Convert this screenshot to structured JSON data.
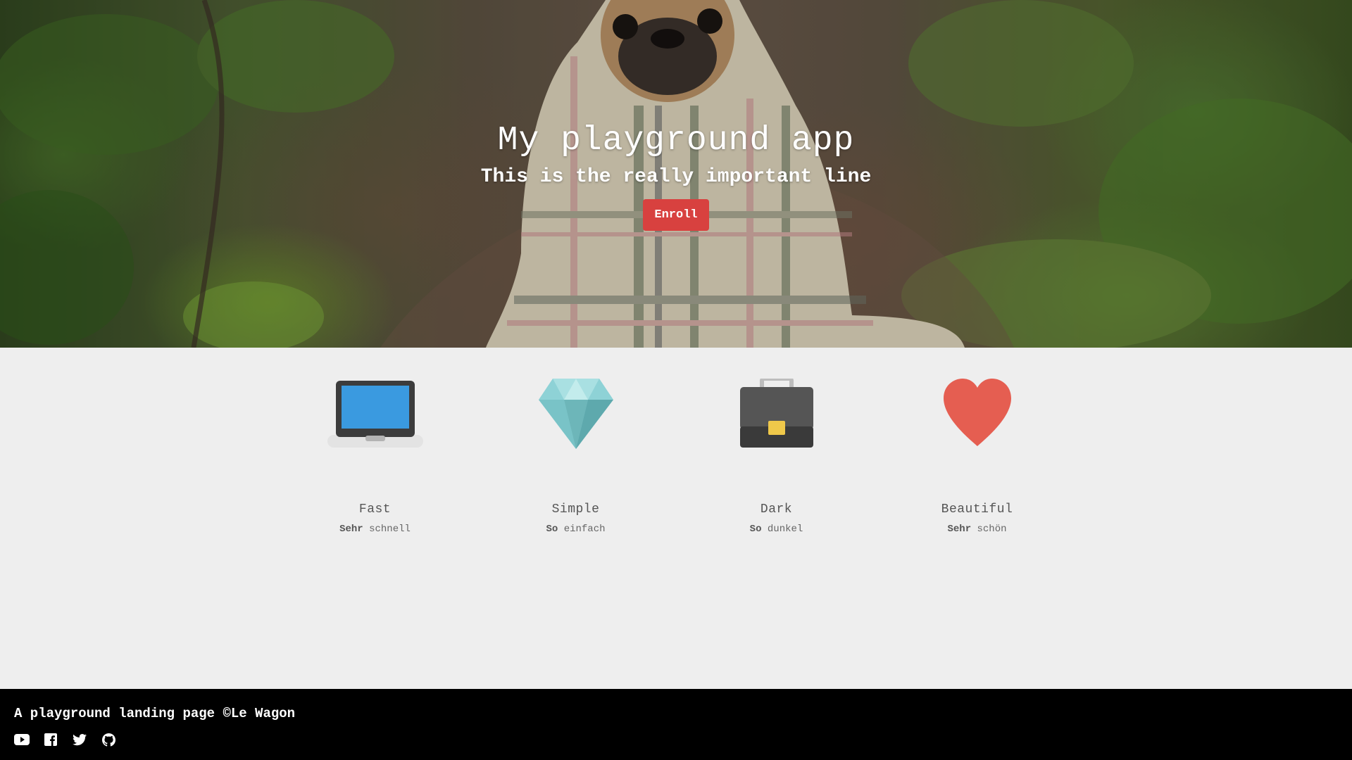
{
  "hero": {
    "title": "My playground app",
    "subtitle": "This is the really important line",
    "cta_label": "Enroll",
    "cta_color": "#d8413f"
  },
  "features": [
    {
      "icon": "laptop-icon",
      "title": "Fast",
      "desc_bold": "Sehr",
      "desc_rest": "schnell"
    },
    {
      "icon": "diamond-icon",
      "title": "Simple",
      "desc_bold": "So",
      "desc_rest": "einfach"
    },
    {
      "icon": "briefcase-icon",
      "title": "Dark",
      "desc_bold": "So",
      "desc_rest": "dunkel"
    },
    {
      "icon": "heart-icon",
      "title": "Beautiful",
      "desc_bold": "Sehr",
      "desc_rest": "schön"
    }
  ],
  "footer": {
    "text": "A playground landing page ©Le Wagon",
    "social": [
      "youtube-icon",
      "facebook-icon",
      "twitter-icon",
      "github-icon"
    ]
  },
  "colors": {
    "page_background": "#eeeeee",
    "footer_background": "#000000",
    "heart": "#e55e51",
    "laptop_screen": "#3a9ae0",
    "diamond": "#8ed2d6",
    "briefcase": "#4a4a4a",
    "briefcase_clasp": "#efc84a"
  }
}
